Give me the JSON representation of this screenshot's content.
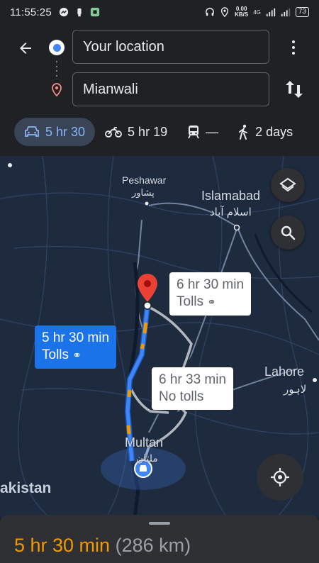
{
  "status_bar": {
    "time": "11:55:25",
    "speed": "0.00\nKB/S",
    "network": "4G",
    "battery": "73"
  },
  "directions": {
    "origin": "Your location",
    "destination": "Mianwali",
    "modes": [
      {
        "icon": "car-icon",
        "label": "5 hr 30",
        "active": true
      },
      {
        "icon": "motorcycle-icon",
        "label": "5 hr 19",
        "active": false
      },
      {
        "icon": "transit-icon",
        "label": "—",
        "active": false
      },
      {
        "icon": "walk-icon",
        "label": "2 days",
        "active": false
      }
    ]
  },
  "map": {
    "places": {
      "peshawar": "Peshawar",
      "peshawar_urdu": "پشاور",
      "islamabad": "Islamabad",
      "islamabad_urdu": "اسلام آباد",
      "lahore": "Lahore",
      "lahore_urdu": "لاہور",
      "multan": "Multan",
      "multan_urdu": "ملتان",
      "pakistan": "akistan"
    },
    "routes": [
      {
        "time": "5 hr 30 min",
        "note": "Tolls",
        "selected": true
      },
      {
        "time": "6 hr 30 min",
        "note": "Tolls",
        "selected": false
      },
      {
        "time": "6 hr 33 min",
        "note": "No tolls",
        "selected": false
      }
    ]
  },
  "summary": {
    "duration": "5 hr 30 min",
    "distance": "(286 km)"
  },
  "colors": {
    "accent_blue": "#1a73e8",
    "route_blue": "#4285f4",
    "duration_orange": "#f29900",
    "map_bg": "#1e2a3d",
    "alt_route": "#aeb7c4"
  }
}
